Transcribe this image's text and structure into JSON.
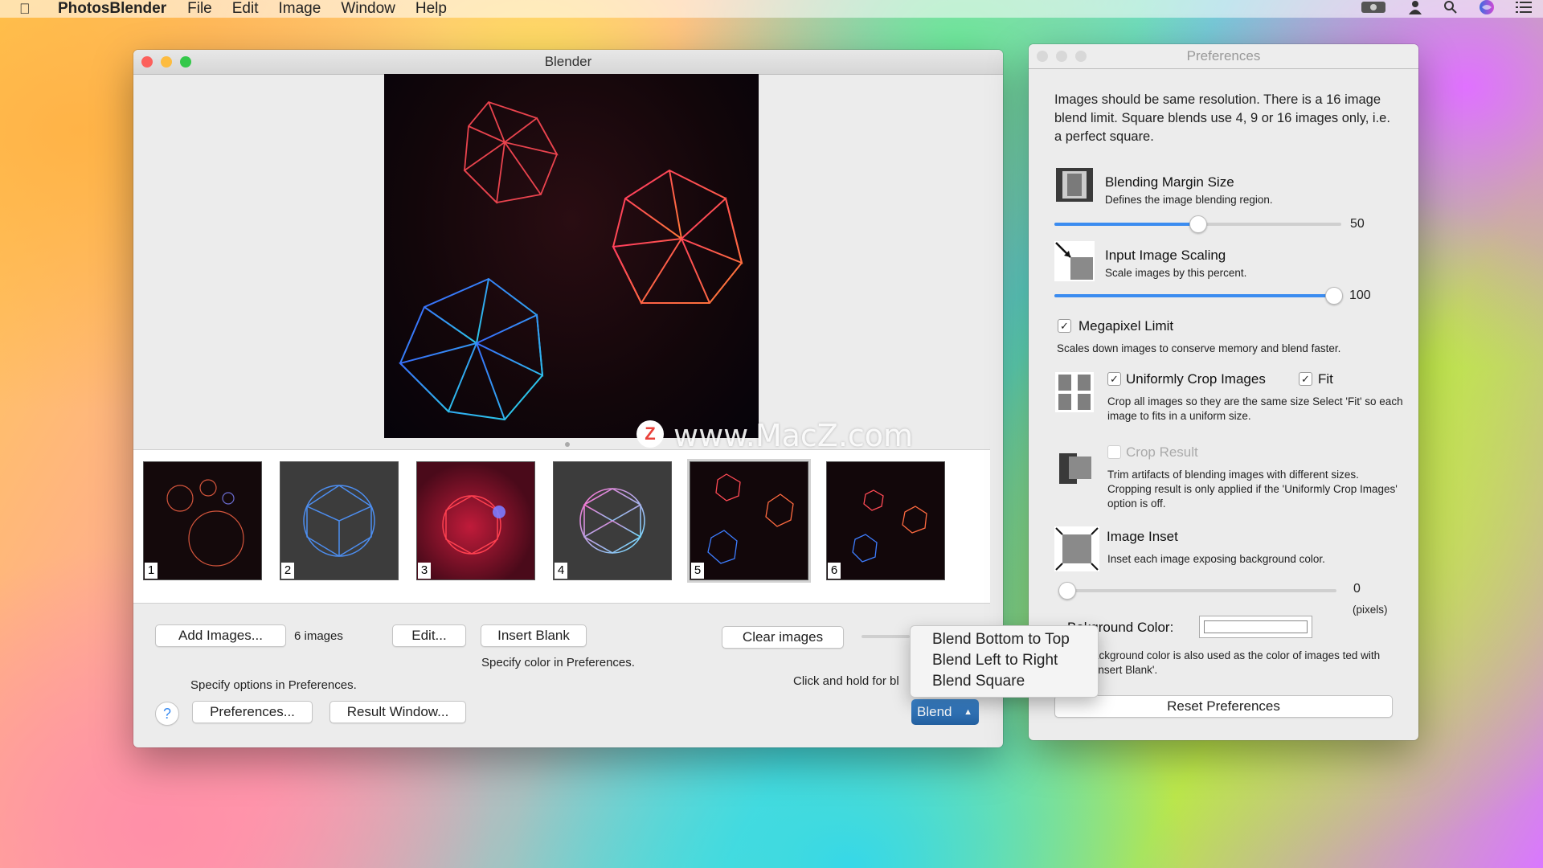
{
  "menubar": {
    "app_name": "PhotosBlender",
    "menus": [
      "File",
      "Edit",
      "Image",
      "Window",
      "Help"
    ],
    "status_icons": [
      "screen-icon",
      "user-icon",
      "search-icon",
      "siri-icon",
      "list-icon"
    ]
  },
  "blender": {
    "title": "Blender",
    "thumbnails": [
      {
        "number": "1"
      },
      {
        "number": "2"
      },
      {
        "number": "3"
      },
      {
        "number": "4"
      },
      {
        "number": "5"
      },
      {
        "number": "6"
      }
    ],
    "selected_thumbnail": 5,
    "add_images_label": "Add Images...",
    "image_count": "6 images",
    "edit_label": "Edit...",
    "insert_blank_label": "Insert Blank",
    "insert_blank_hint": "Specify color in Preferences.",
    "clear_images_label": "Clear images",
    "options_hint": "Specify options in Preferences.",
    "hold_hint": "Click and hold for bl",
    "help_label": "?",
    "preferences_label": "Preferences...",
    "result_window_label": "Result Window...",
    "blend_label": "Blend",
    "blend_menu": [
      "Blend Bottom to Top",
      "Blend Left to Right",
      "Blend Square"
    ]
  },
  "watermark": {
    "logo": "Z",
    "text": "www.MacZ.com"
  },
  "preferences": {
    "title": "Preferences",
    "intro": "Images should be same resolution. There is a 16 image blend limit. Square blends use 4, 9 or 16 images only, i.e. a perfect square.",
    "margin": {
      "title": "Blending Margin Size",
      "desc": "Defines the image blending region.",
      "value": "50",
      "fraction": 0.5
    },
    "scaling": {
      "title": "Input Image Scaling",
      "desc": "Scale images by this percent.",
      "value": "100",
      "fraction": 1.0
    },
    "megapixel": {
      "label": "Megapixel Limit",
      "checked": true,
      "desc": "Scales down images to conserve memory and blend faster."
    },
    "crop": {
      "label": "Uniformly Crop Images",
      "checked": true,
      "fit_label": "Fit",
      "fit_checked": true,
      "desc": "Crop all images so they are the same size Select 'Fit' so each image to fits in a uniform size."
    },
    "crop_result": {
      "label": "Crop Result",
      "checked": false,
      "desc": "Trim artifacts of blending images with different sizes. Cropping result is only applied if the 'Uniformly Crop Images' option is off."
    },
    "inset": {
      "title": "Image Inset",
      "desc": "Inset each image exposing background color.",
      "value": "0",
      "unit": "(pixels)",
      "fraction": 0.0
    },
    "background": {
      "label": "kground Color:",
      "label_prefix": "Ba",
      "color": "#ffffff",
      "desc": "ackground color is also used as the color of images ted with 'Insert Blank'."
    },
    "reset_label": "Reset Preferences"
  },
  "colors": {
    "accent": "#3b8cf0",
    "blend_button": "#2a6fb5",
    "close": "#fc605c",
    "minimize": "#fdbc40",
    "zoom": "#34c84a"
  }
}
